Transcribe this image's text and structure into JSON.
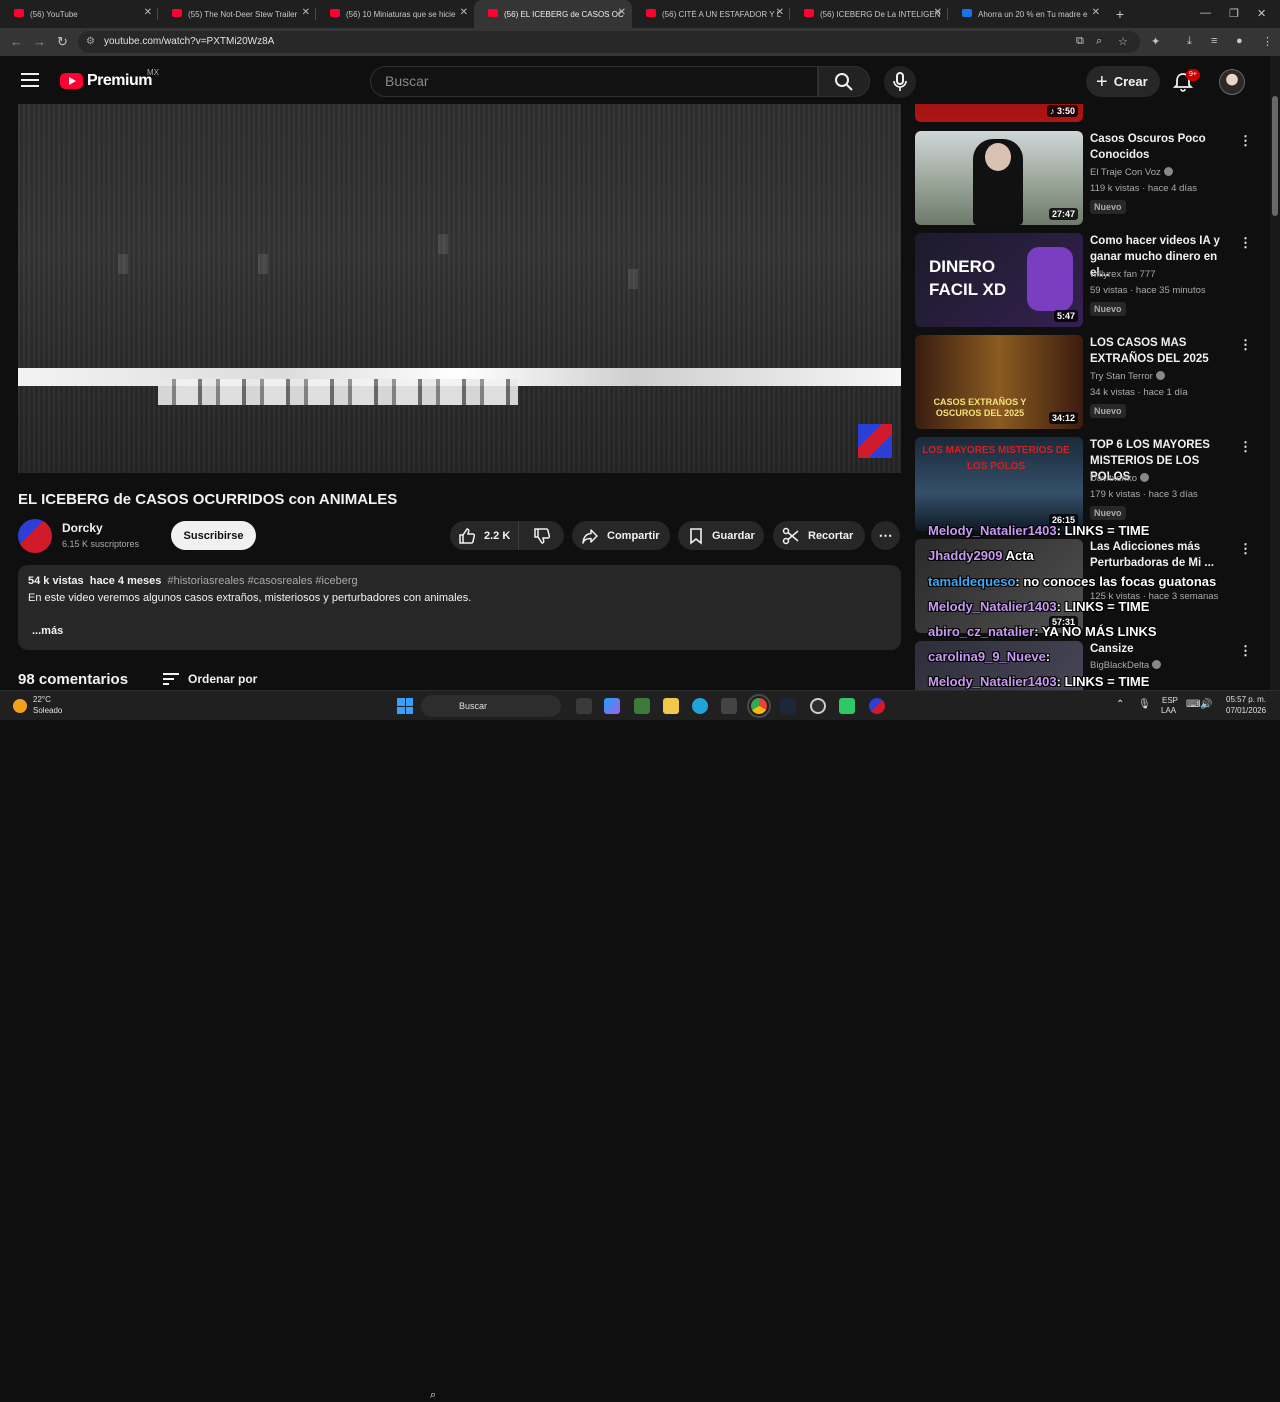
{
  "browser": {
    "tabs": [
      {
        "title": "(56) YouTube",
        "icon": "youtube-icon",
        "active": false
      },
      {
        "title": "(55) The Not-Deer Stew Trailer",
        "icon": "youtube-icon",
        "active": false
      },
      {
        "title": "(56) 10 Miniaturas que se hicie",
        "icon": "youtube-icon",
        "active": false
      },
      {
        "title": "(56) EL ICEBERG de CASOS OC",
        "icon": "youtube-icon",
        "active": true
      },
      {
        "title": "(56) CITÉ A UN ESTAFADOR Y L",
        "icon": "youtube-icon",
        "active": false
      },
      {
        "title": "(56) ICEBERG De La INTELIGEN",
        "icon": "youtube-icon",
        "active": false
      },
      {
        "title": "Ahorra un 20 % en Tu madre e",
        "icon": "checkmark-icon",
        "active": false
      }
    ],
    "url": "youtube.com/watch?v=PXTMi20Wz8A"
  },
  "masthead": {
    "logo_text": "Premium",
    "region": "MX",
    "search_placeholder": "Buscar",
    "create_label": "Crear",
    "notifications_badge": "9+"
  },
  "video": {
    "title": "EL ICEBERG de CASOS OCURRIDOS con ANIMALES",
    "channel_name": "Dorcky",
    "channel_subs": "6.15 K suscriptores",
    "subscribe_label": "Suscribirse",
    "likes": "2.2 K",
    "share_label": "Compartir",
    "save_label": "Guardar",
    "clip_label": "Recortar",
    "more_label": "⋯"
  },
  "description": {
    "views": "54 k vistas",
    "age": "hace 4 meses",
    "tags": "#historiasreales #casosreales #iceberg",
    "text": "En este video veremos algunos casos extraños, misteriosos y perturbadores con animales.",
    "more": "...más"
  },
  "comments": {
    "count": "98 comentarios",
    "sort_label": "Ordenar por"
  },
  "related": [
    {
      "title": "",
      "channel": "",
      "meta": "",
      "badge": "",
      "duration": "3:50"
    },
    {
      "title": "Casos Oscuros Poco Conocidos",
      "channel": "El Traje Con Voz",
      "meta": "119 k vistas · hace 4 días",
      "badge": "Nuevo",
      "duration": "27:47",
      "thumb_text": ""
    },
    {
      "title": "Como hacer videos IA y ganar mucho dinero en el...",
      "channel": "willyrex fan 777",
      "meta": "59 vistas · hace 35 minutos",
      "badge": "Nuevo",
      "duration": "5:47",
      "thumb_text": "DINERO FACIL XD"
    },
    {
      "title": "LOS CASOS MAS EXTRAÑOS DEL 2025",
      "channel": "Try Stan Terror",
      "meta": "34 k vistas · hace 1 día",
      "badge": "Nuevo",
      "duration": "34:12",
      "thumb_text": "CASOS EXTRAÑOS Y OSCUROS DEL 2025"
    },
    {
      "title": "TOP 6 LOS MAYORES MISTERIOS DE LOS POLOS",
      "channel": "Davitxenko",
      "meta": "179 k vistas · hace 3 días",
      "badge": "Nuevo",
      "duration": "26:15",
      "thumb_text": "LOS MAYORES MISTERIOS DE LOS POLOS"
    },
    {
      "title": "Las Adicciones más Perturbadoras de Mi ...",
      "channel": "",
      "meta": "125 k vistas · hace 3 semanas",
      "badge": "",
      "duration": "57:31"
    },
    {
      "title": "Cansize",
      "channel": "BigBlackDelta",
      "meta": "",
      "badge": "",
      "duration": ""
    }
  ],
  "chat_overlay": [
    {
      "user": "Melody_Natalier1403",
      "msg": ": LINKS = TIME"
    },
    {
      "user": "Jhaddy2909",
      "msg": "Acta"
    },
    {
      "user": "tamaldequeso",
      "msg": ": no conoces las focas guatonas"
    },
    {
      "user": "Melody_Natalier1403",
      "msg": ": LINKS = TIME"
    },
    {
      "user": "abiro_cz_natalier",
      "msg": ": YA NO MÁS LINKS"
    },
    {
      "user": "carolina9_9_Nueve",
      "msg": ":"
    },
    {
      "user": "Melody_Natalier1403",
      "msg": ": LINKS = TIME"
    }
  ],
  "taskbar": {
    "temperature": "22°C",
    "condition": "Soleado",
    "search_label": "Buscar",
    "lang": "ESP",
    "layout": "LAA",
    "time": "05:57 p. m.",
    "date": "07/01/2026"
  },
  "colors": {
    "accent": "#ff0033",
    "background": "#0f0f0f",
    "chat_user": "#c99af3"
  }
}
